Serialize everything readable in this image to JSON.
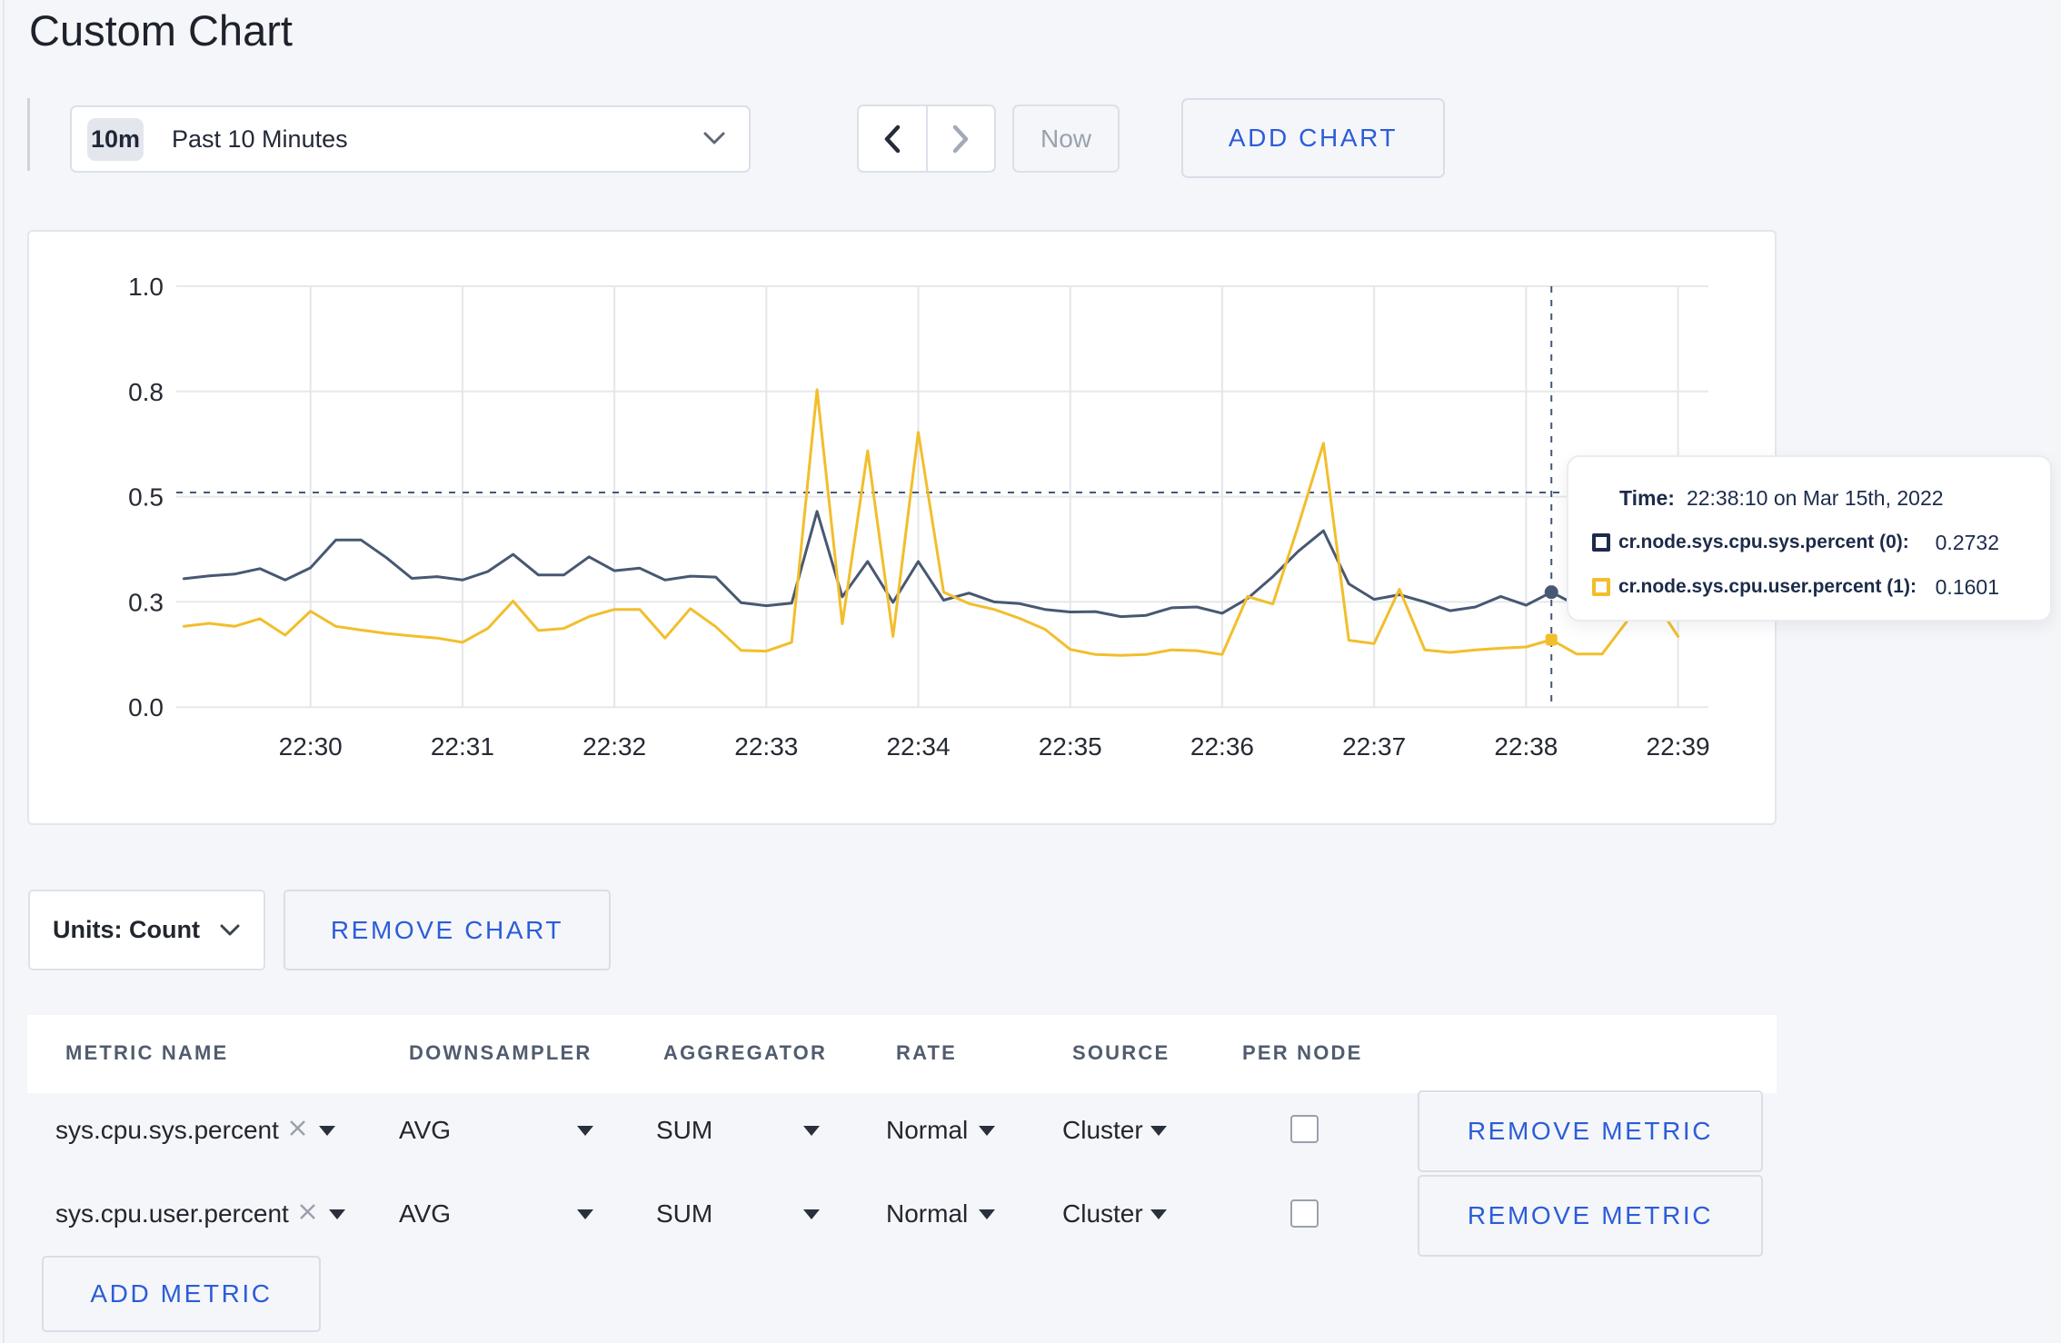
{
  "colors": {
    "accent_blue": "#2b5dd9",
    "series_sys": "#475872",
    "series_user": "#f2be2c",
    "page_background": "#f5f6f9"
  },
  "header": {
    "title": "Custom Chart"
  },
  "toolbar": {
    "time_range": {
      "badge": "10m",
      "label": "Past 10 Minutes"
    },
    "now_label": "Now",
    "add_chart_label": "ADD CHART"
  },
  "chart_data": {
    "type": "line",
    "title": "",
    "xlabel": "",
    "ylabel": "",
    "ylim": [
      0,
      1
    ],
    "y_ticks": [
      {
        "value": 0,
        "label": "0.0"
      },
      {
        "value": 0.25,
        "label": "0.3"
      },
      {
        "value": 0.5,
        "label": "0.5"
      },
      {
        "value": 0.75,
        "label": "0.8"
      },
      {
        "value": 1,
        "label": "1.0"
      }
    ],
    "x_ticks": [
      {
        "t": 0,
        "label": "22:30"
      },
      {
        "t": 60,
        "label": "22:31"
      },
      {
        "t": 120,
        "label": "22:32"
      },
      {
        "t": 180,
        "label": "22:33"
      },
      {
        "t": 240,
        "label": "22:34"
      },
      {
        "t": 300,
        "label": "22:35"
      },
      {
        "t": 360,
        "label": "22:36"
      },
      {
        "t": 420,
        "label": "22:37"
      },
      {
        "t": 480,
        "label": "22:38"
      },
      {
        "t": 540,
        "label": "22:39"
      }
    ],
    "x_domain_seconds_rel_2230": [
      -53,
      552
    ],
    "grid": true,
    "legend_position": "tooltip",
    "series": [
      {
        "name": "cr.node.sys.cpu.sys.percent",
        "color": "#475872",
        "marker": "circle",
        "points": [
          [
            -50,
            0.305
          ],
          [
            -40,
            0.312
          ],
          [
            -30,
            0.316
          ],
          [
            -20,
            0.329
          ],
          [
            -10,
            0.302
          ],
          [
            0,
            0.331
          ],
          [
            10,
            0.397
          ],
          [
            20,
            0.397
          ],
          [
            30,
            0.355
          ],
          [
            40,
            0.306
          ],
          [
            50,
            0.31
          ],
          [
            60,
            0.302
          ],
          [
            70,
            0.322
          ],
          [
            80,
            0.363
          ],
          [
            90,
            0.314
          ],
          [
            100,
            0.314
          ],
          [
            110,
            0.357
          ],
          [
            120,
            0.324
          ],
          [
            130,
            0.33
          ],
          [
            140,
            0.302
          ],
          [
            150,
            0.311
          ],
          [
            160,
            0.309
          ],
          [
            170,
            0.248
          ],
          [
            180,
            0.241
          ],
          [
            190,
            0.247
          ],
          [
            200,
            0.465
          ],
          [
            210,
            0.262
          ],
          [
            220,
            0.346
          ],
          [
            230,
            0.249
          ],
          [
            240,
            0.346
          ],
          [
            250,
            0.254
          ],
          [
            260,
            0.271
          ],
          [
            270,
            0.25
          ],
          [
            280,
            0.246
          ],
          [
            290,
            0.232
          ],
          [
            300,
            0.226
          ],
          [
            310,
            0.227
          ],
          [
            320,
            0.215
          ],
          [
            330,
            0.218
          ],
          [
            340,
            0.236
          ],
          [
            350,
            0.238
          ],
          [
            360,
            0.223
          ],
          [
            370,
            0.258
          ],
          [
            380,
            0.31
          ],
          [
            390,
            0.37
          ],
          [
            400,
            0.419
          ],
          [
            410,
            0.293
          ],
          [
            420,
            0.256
          ],
          [
            430,
            0.267
          ],
          [
            440,
            0.25
          ],
          [
            450,
            0.229
          ],
          [
            460,
            0.238
          ],
          [
            470,
            0.263
          ],
          [
            480,
            0.242
          ],
          [
            490,
            0.2732
          ],
          [
            500,
            0.242
          ],
          [
            510,
            0.252
          ],
          [
            520,
            0.26
          ],
          [
            530,
            0.246
          ],
          [
            540,
            0.25
          ]
        ]
      },
      {
        "name": "cr.node.sys.cpu.user.percent",
        "color": "#f2be2c",
        "marker": "square",
        "points": [
          [
            -50,
            0.192
          ],
          [
            -40,
            0.199
          ],
          [
            -30,
            0.192
          ],
          [
            -20,
            0.21
          ],
          [
            -10,
            0.171
          ],
          [
            0,
            0.228
          ],
          [
            10,
            0.192
          ],
          [
            20,
            0.183
          ],
          [
            30,
            0.175
          ],
          [
            40,
            0.169
          ],
          [
            50,
            0.164
          ],
          [
            60,
            0.154
          ],
          [
            70,
            0.187
          ],
          [
            80,
            0.252
          ],
          [
            90,
            0.182
          ],
          [
            100,
            0.187
          ],
          [
            110,
            0.215
          ],
          [
            120,
            0.232
          ],
          [
            130,
            0.232
          ],
          [
            140,
            0.164
          ],
          [
            150,
            0.234
          ],
          [
            160,
            0.191
          ],
          [
            170,
            0.135
          ],
          [
            180,
            0.133
          ],
          [
            190,
            0.154
          ],
          [
            200,
            0.754
          ],
          [
            210,
            0.198
          ],
          [
            220,
            0.609
          ],
          [
            230,
            0.168
          ],
          [
            240,
            0.653
          ],
          [
            250,
            0.273
          ],
          [
            260,
            0.246
          ],
          [
            270,
            0.232
          ],
          [
            280,
            0.211
          ],
          [
            290,
            0.185
          ],
          [
            300,
            0.137
          ],
          [
            310,
            0.125
          ],
          [
            320,
            0.123
          ],
          [
            330,
            0.125
          ],
          [
            340,
            0.136
          ],
          [
            350,
            0.134
          ],
          [
            360,
            0.125
          ],
          [
            370,
            0.263
          ],
          [
            380,
            0.245
          ],
          [
            390,
            0.43
          ],
          [
            400,
            0.627
          ],
          [
            410,
            0.159
          ],
          [
            420,
            0.151
          ],
          [
            430,
            0.28
          ],
          [
            440,
            0.136
          ],
          [
            450,
            0.13
          ],
          [
            460,
            0.136
          ],
          [
            470,
            0.14
          ],
          [
            480,
            0.143
          ],
          [
            490,
            0.1601
          ],
          [
            500,
            0.126
          ],
          [
            510,
            0.126
          ],
          [
            520,
            0.205
          ],
          [
            530,
            0.26
          ],
          [
            540,
            0.168
          ]
        ]
      }
    ],
    "crosshair": {
      "t": 490,
      "y_value": 0.51
    },
    "tooltip": {
      "time_label": "Time:",
      "time_value": "22:38:10 on Mar 15th, 2022",
      "entries": [
        {
          "label": "cr.node.sys.cpu.sys.percent (0):",
          "value": "0.2732",
          "color": "#475872"
        },
        {
          "label": "cr.node.sys.cpu.user.percent (1):",
          "value": "0.1601",
          "color": "#f2be2c"
        }
      ]
    }
  },
  "chart_controls": {
    "units_label": "Units: Count",
    "remove_chart_label": "REMOVE CHART"
  },
  "metrics_table": {
    "headers": [
      "METRIC NAME",
      "DOWNSAMPLER",
      "AGGREGATOR",
      "RATE",
      "SOURCE",
      "PER NODE"
    ],
    "rows": [
      {
        "metric_name": "sys.cpu.sys.percent",
        "downsampler": "AVG",
        "aggregator": "SUM",
        "rate": "Normal",
        "source": "Cluster",
        "per_node_checked": false,
        "remove_label": "REMOVE METRIC"
      },
      {
        "metric_name": "sys.cpu.user.percent",
        "downsampler": "AVG",
        "aggregator": "SUM",
        "rate": "Normal",
        "source": "Cluster",
        "per_node_checked": false,
        "remove_label": "REMOVE METRIC"
      }
    ],
    "add_metric_label": "ADD METRIC"
  }
}
